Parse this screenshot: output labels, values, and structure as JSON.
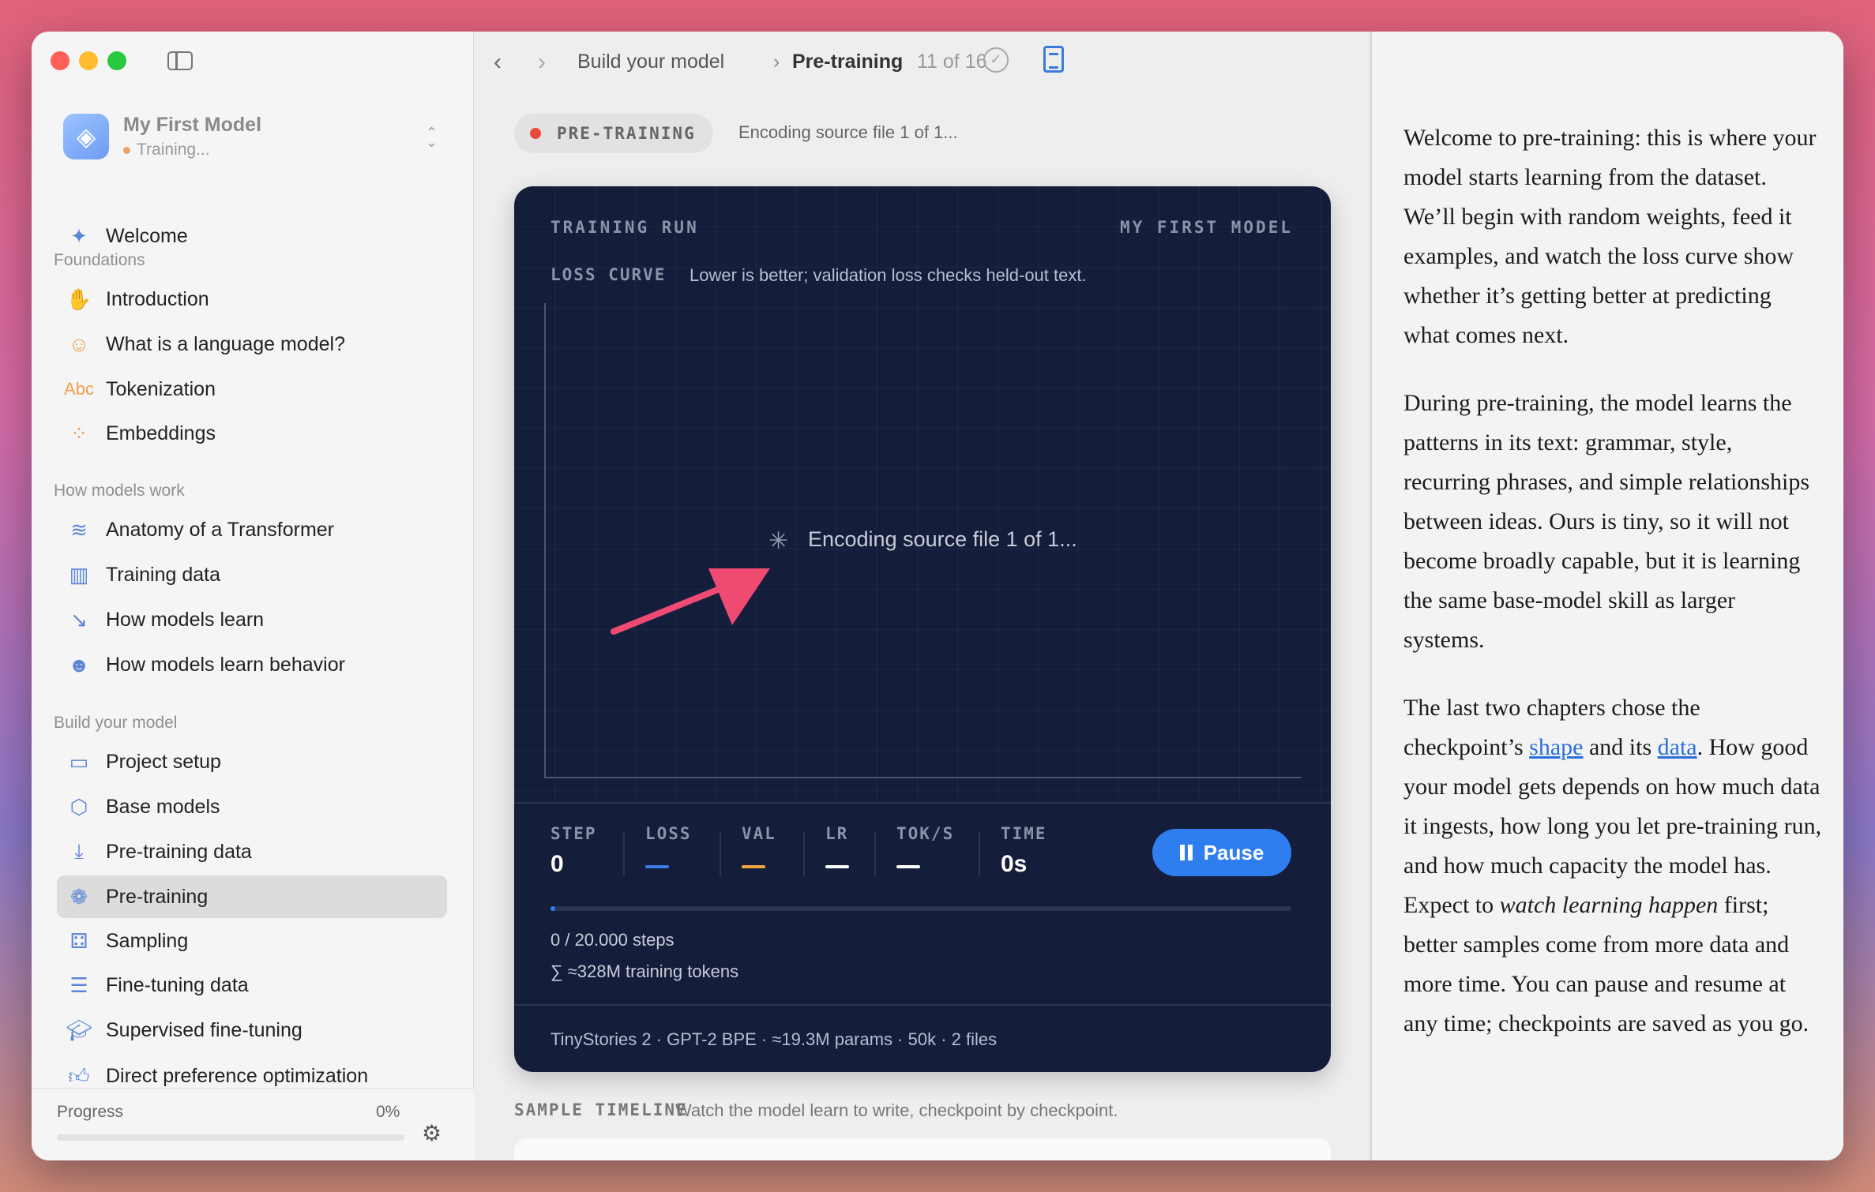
{
  "sidebar": {
    "model": {
      "name": "My First Model",
      "status": "Training..."
    },
    "welcome": "Welcome",
    "sections": [
      {
        "title": "Foundations",
        "items": [
          "Introduction",
          "What is a language model?",
          "Tokenization",
          "Embeddings"
        ]
      },
      {
        "title": "How models work",
        "items": [
          "Anatomy of a Transformer",
          "Training data",
          "How models learn",
          "How models learn behavior"
        ]
      },
      {
        "title": "Build your model",
        "items": [
          "Project setup",
          "Base models",
          "Pre-training data",
          "Pre-training",
          "Sampling",
          "Fine-tuning data",
          "Supervised fine-tuning",
          "Direct preference optimization"
        ]
      }
    ],
    "icon_prefix": "Abc",
    "progress": {
      "label": "Progress",
      "value": "0%"
    }
  },
  "topbar": {
    "crumb_parent": "Build your model",
    "crumb_sep": "›",
    "crumb_current": "Pre-training",
    "page_counter": "11 of 16"
  },
  "status": {
    "badge": "PRE-TRAINING",
    "text": "Encoding source file 1 of 1..."
  },
  "card": {
    "header_left": "TRAINING RUN",
    "header_right": "MY FIRST MODEL",
    "loss_title": "LOSS CURVE",
    "loss_subtitle": "Lower is better; validation loss checks held-out text.",
    "overlay": "Encoding source file 1 of 1...",
    "stats": {
      "step_label": "STEP",
      "step_value": "0",
      "loss_label": "LOSS",
      "val_label": "VAL",
      "lr_label": "LR",
      "toks_label": "TOK/S",
      "time_label": "TIME",
      "time_value": "0s"
    },
    "pause_label": "Pause",
    "steps_text": "0 / 20.000 steps",
    "tokens_text": "∑  ≈328M training tokens",
    "footer": "TinyStories 2  ·  GPT-2 BPE  ·  ≈19.3M params  ·  50k  ·  2 files",
    "colors": {
      "loss": "#3b7ee8",
      "val": "#f0a640",
      "accent": "#2f7ef0"
    }
  },
  "sample": {
    "title": "SAMPLE TIMELINE",
    "subtitle": "Watch the model learn to write, checkpoint by checkpoint."
  },
  "reader": {
    "p1": "Welcome to pre-training: this is where your model starts learning from the dataset. We’ll begin with random weights, feed it examples, and watch the loss curve show whether it’s getting better at predicting what comes next.",
    "p2": "During pre-training, the model learns the patterns in its text: grammar, style, recurring phrases, and simple relationships between ideas. Ours is tiny, so it will not become broadly capable, but it is learning the same base-model skill as larger systems.",
    "p3_a": "The last two chapters chose the checkpoint’s ",
    "p3_link1": "shape",
    "p3_b": " and its ",
    "p3_link2": "data",
    "p3_c": ". How good your model gets depends on how much data it ingests, how long you let pre-training run, and how much capacity the model has. Expect to ",
    "p3_em": "watch learning happen",
    "p3_d": " first; better samples come from more data and more time. You can pause and resume at any time; checkpoints are saved as you go."
  }
}
